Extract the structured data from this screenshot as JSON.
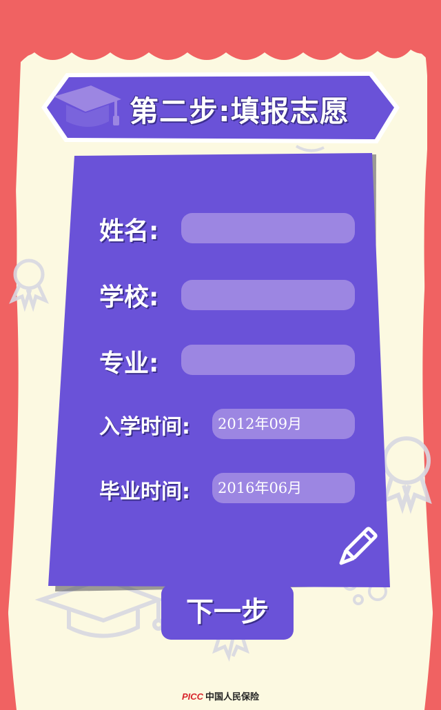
{
  "title": "第二步:填报志愿",
  "form": {
    "name_label": "姓名:",
    "school_label": "学校:",
    "major_label": "专业:",
    "enroll_label": "入学时间:",
    "enroll_value": "2012年09月",
    "grad_label": "毕业时间:",
    "grad_value": "2016年06月"
  },
  "next_label": "下一步",
  "footer": {
    "brand": "PICC",
    "company": "中国人民保险"
  },
  "colors": {
    "curtain": "#f06262",
    "paper": "#fcf9e1",
    "primary": "#6a52d8",
    "field": "#9c86e2"
  }
}
